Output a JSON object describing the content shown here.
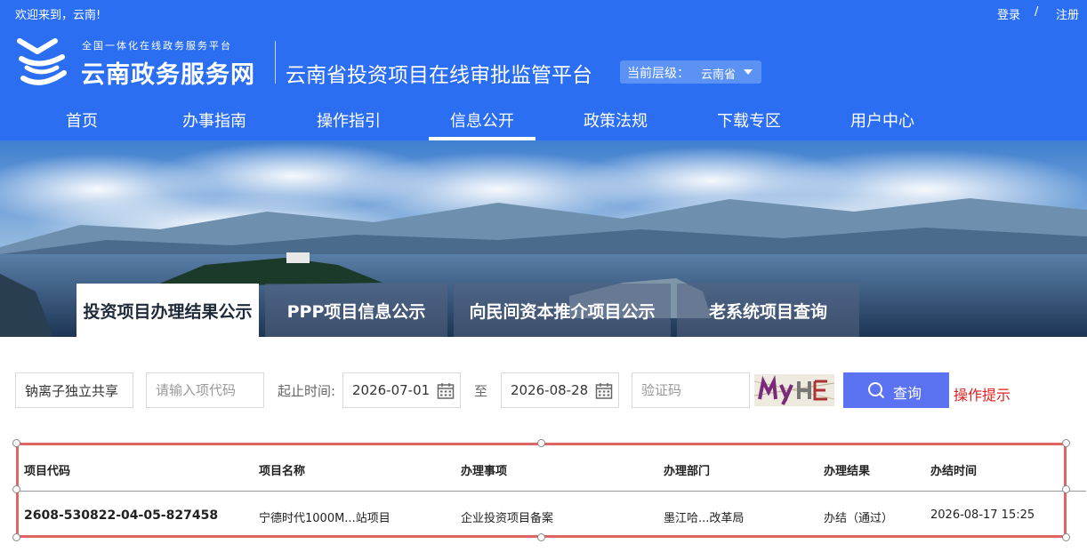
{
  "top_bar": {
    "welcome": "欢迎来到，云南!",
    "login": "登录",
    "separator": "/",
    "register": "注册"
  },
  "brand": {
    "subtitle": "全国一体化在线政务服务平台",
    "title": "云南政务服务网",
    "platform": "云南省投资项目在线审批监管平台",
    "level_label": "当前层级：",
    "level_value": "云南省"
  },
  "nav": {
    "items": [
      "首页",
      "办事指南",
      "操作指引",
      "信息公开",
      "政策法规",
      "下载专区",
      "用户中心"
    ],
    "active": "信息公开"
  },
  "tabs": [
    "投资项目办理结果公示",
    "PPP项目信息公示",
    "向民间资本推介项目公示",
    "老系统项目查询"
  ],
  "search": {
    "keyword_value": "钠离子独立共享",
    "code_placeholder": "请输入项代码",
    "date_label": "起止时间:",
    "start_date": "2026-07-01",
    "to_label": "至",
    "end_date": "2026-08-28",
    "captcha_placeholder": "验证码",
    "query_label": "查询",
    "hint_label": "操作提示"
  },
  "table": {
    "headers": [
      "项目代码",
      "项目名称",
      "办理事项",
      "办理部门",
      "办理结果",
      "办结时间"
    ],
    "rows": [
      [
        "2608-530822-04-05-827458",
        "宁德时代1000M...站项目",
        "企业投资项目备案",
        "墨江哈...改革局",
        "办结（通过）",
        "2026-08-17 15:25"
      ]
    ]
  },
  "colors": {
    "header_blue": "#2c6ef2",
    "query_button": "#5b73f2",
    "hint_red": "#e01e1e",
    "table_outline": "#e06666"
  }
}
